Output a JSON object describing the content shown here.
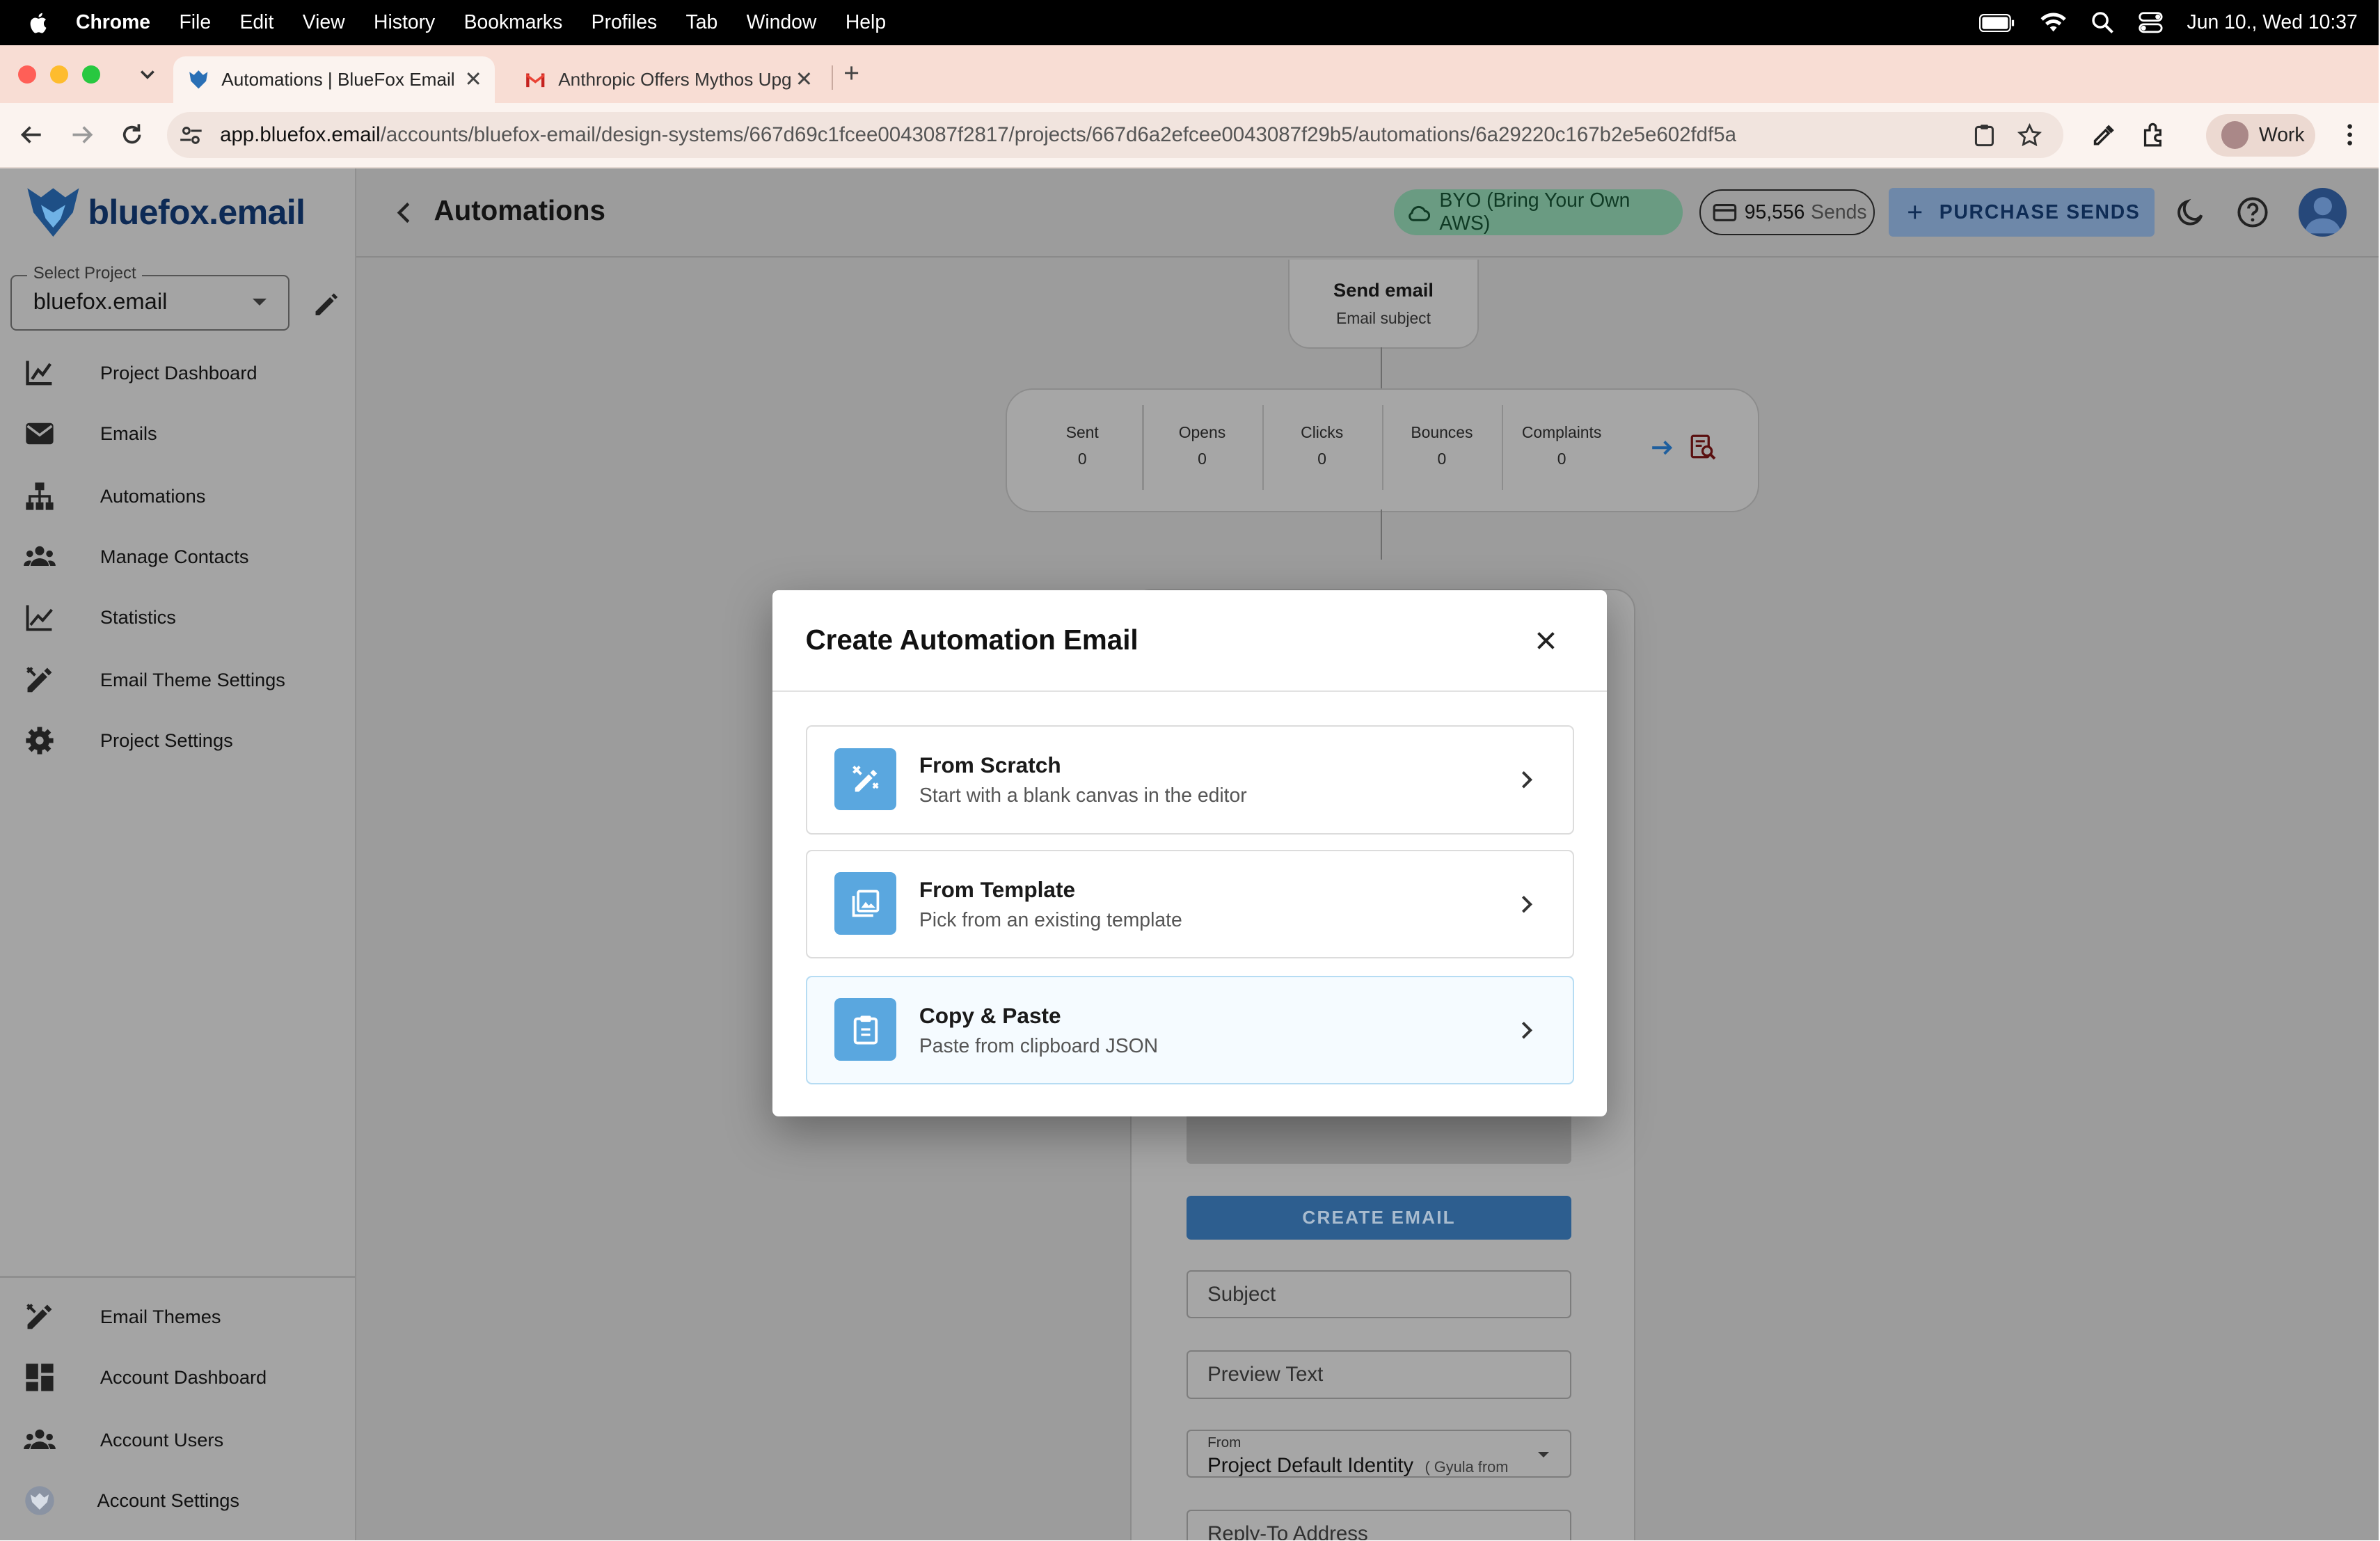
{
  "menubar": {
    "items": [
      "Chrome",
      "File",
      "Edit",
      "View",
      "History",
      "Bookmarks",
      "Profiles",
      "Tab",
      "Window",
      "Help"
    ],
    "datetime": "Jun 10., Wed  10:37"
  },
  "browser": {
    "tabs": [
      {
        "title": "Automations | BlueFox Email"
      },
      {
        "title": "Anthropic Offers Mythos Upg"
      }
    ],
    "url_host": "app.bluefox.email",
    "url_path": "/accounts/bluefox-email/design-systems/667d69c1fcee0043087f2817/projects/667d6a2efcee0043087f29b5/automations/6a29220c167b2e5e602fdf5a",
    "profile": "Work"
  },
  "sidebar": {
    "logo_text": "bluefox",
    "logo_suffix": ".email",
    "project_label": "Select Project",
    "project_value": "bluefox.email",
    "nav": [
      {
        "label": "Project Dashboard",
        "icon": "chart-icon"
      },
      {
        "label": "Emails",
        "icon": "mail-icon"
      },
      {
        "label": "Automations",
        "icon": "sitemap-icon"
      },
      {
        "label": "Manage Contacts",
        "icon": "people-icon"
      },
      {
        "label": "Statistics",
        "icon": "line-chart-icon"
      },
      {
        "label": "Email Theme Settings",
        "icon": "design-icon"
      },
      {
        "label": "Project Settings",
        "icon": "gear-icon"
      }
    ],
    "bottom_nav": [
      {
        "label": "Email Themes",
        "icon": "design-icon"
      },
      {
        "label": "Account Dashboard",
        "icon": "dashboard-icon"
      },
      {
        "label": "Account Users",
        "icon": "people-icon"
      },
      {
        "label": "Account Settings",
        "icon": "account-logo-icon"
      }
    ]
  },
  "header": {
    "title": "Automations",
    "byo_label": "BYO (Bring Your Own AWS)",
    "sends_count": "95,556",
    "sends_unit": "Sends",
    "purchase_label": "PURCHASE SENDS"
  },
  "flow": {
    "node_title": "Send email",
    "node_subtitle": "Email subject",
    "stats": [
      {
        "label": "Sent",
        "value": "0"
      },
      {
        "label": "Opens",
        "value": "0"
      },
      {
        "label": "Clicks",
        "value": "0"
      },
      {
        "label": "Bounces",
        "value": "0"
      },
      {
        "label": "Complaints",
        "value": "0"
      }
    ]
  },
  "panel": {
    "create_label": "CREATE EMAIL",
    "subject_placeholder": "Subject",
    "preview_placeholder": "Preview Text",
    "from_label": "From",
    "from_value": "Project Default Identity",
    "from_hint": "( Gyula from",
    "reply_placeholder": "Reply-To Address"
  },
  "modal": {
    "title": "Create Automation Email",
    "options": [
      {
        "title": "From Scratch",
        "subtitle": "Start with a blank canvas in the editor",
        "icon": "design-icon"
      },
      {
        "title": "From Template",
        "subtitle": "Pick from an existing template",
        "icon": "image-library-icon"
      },
      {
        "title": "Copy & Paste",
        "subtitle": "Paste from clipboard JSON",
        "icon": "clipboard-icon"
      }
    ]
  },
  "colors": {
    "accent": "#5aa7df",
    "primary_button": "#2d5e8f",
    "tabstrip": "#f8ddd4"
  }
}
